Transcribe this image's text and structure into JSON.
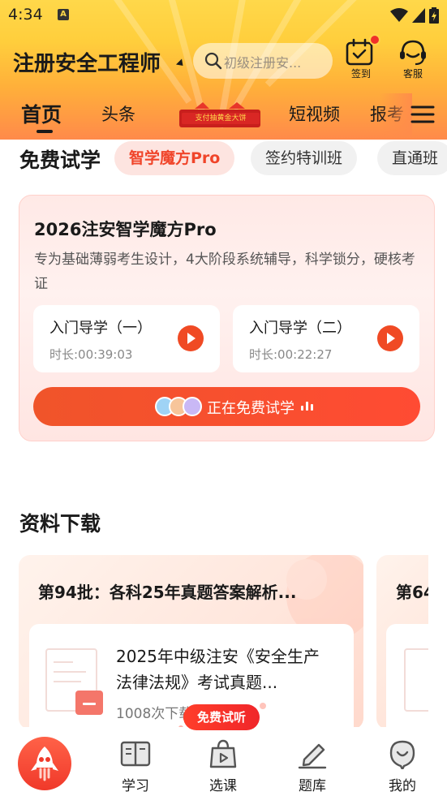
{
  "status_bar": {
    "time": "4:34",
    "indicator": "A"
  },
  "header": {
    "title": "注册安全工程师",
    "search_placeholder": "初级注册安...",
    "signin_label": "签到",
    "service_label": "客服"
  },
  "tabs": [
    {
      "label": "首页",
      "active": true
    },
    {
      "label": "头条"
    },
    {
      "label": "短视频"
    },
    {
      "label": "报考"
    }
  ],
  "promo_banner": {
    "text": "支付抽黄金大饼"
  },
  "free_trial": {
    "title": "免费试学",
    "chips": [
      "智学魔方Pro",
      "签约特训班",
      "直通班"
    ],
    "card": {
      "title": "2026注安智学魔方Pro",
      "description": "专为基础薄弱考生设计，4大阶段系统辅导，科学锁分，硬核考证",
      "lessons": [
        {
          "name": "入门导学（一）",
          "duration": "时长:00:39:03"
        },
        {
          "name": "入门导学（二）",
          "duration": "时长:00:22:27"
        }
      ],
      "cta": "正在免费试学"
    }
  },
  "downloads": {
    "title": "资料下载",
    "cards": [
      {
        "title": "第94批：各科25年真题答案解析...",
        "item_title": "2025年中级注安《安全生产法律法规》考试真题...",
        "item_count": "1008次下载"
      },
      {
        "title": "第64"
      }
    ]
  },
  "free_listen_badge": "免费试听",
  "bottom_nav": [
    {
      "label": "学习"
    },
    {
      "label": "选课"
    },
    {
      "label": "题库"
    },
    {
      "label": "我的"
    }
  ],
  "colors": {
    "accent": "#f0452a",
    "header_yellow": "#ffd84a",
    "header_orange": "#ff8a4a"
  },
  "icons": [
    "search-icon",
    "calendar-check-icon",
    "headset-icon",
    "menu-icon",
    "play-icon",
    "rocket-icon",
    "book-icon",
    "shopping-bag-icon",
    "pencil-icon",
    "smile-face-icon"
  ]
}
